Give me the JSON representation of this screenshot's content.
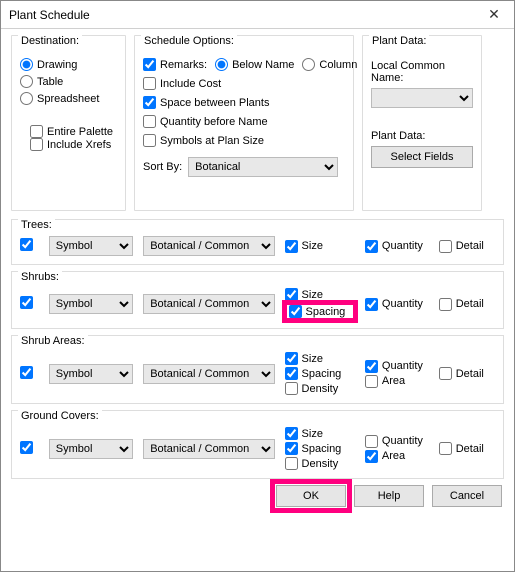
{
  "window": {
    "title": "Plant Schedule",
    "close_icon": "✕"
  },
  "destination": {
    "legend": "Destination:",
    "radios": {
      "drawing": "Drawing",
      "table": "Table",
      "spreadsheet": "Spreadsheet"
    },
    "entire_palette": "Entire Palette",
    "include_xrefs": "Include Xrefs"
  },
  "options": {
    "legend": "Schedule Options:",
    "remarks": "Remarks:",
    "below_name": "Below Name",
    "column": "Column",
    "include_cost": "Include Cost",
    "space_between": "Space between Plants",
    "qty_before": "Quantity before Name",
    "symbols_plan": "Symbols at Plan Size",
    "sort_by": "Sort By:",
    "sort_value": "Botanical"
  },
  "plantdata": {
    "legend": "Plant Data:",
    "lcn_label": "Local Common Name:",
    "lcn_value": "",
    "pd_label": "Plant Data:",
    "select_fields": "Select Fields"
  },
  "columns": {
    "symbol": "Symbol",
    "name": "Botanical / Common",
    "size": "Size",
    "spacing": "Spacing",
    "density": "Density",
    "quantity": "Quantity",
    "area": "Area",
    "detail": "Detail"
  },
  "sections": {
    "trees": {
      "legend": "Trees:"
    },
    "shrubs": {
      "legend": "Shrubs:"
    },
    "shrub_areas": {
      "legend": "Shrub Areas:"
    },
    "ground_covers": {
      "legend": "Ground Covers:"
    }
  },
  "footer": {
    "ok": "OK",
    "help": "Help",
    "cancel": "Cancel"
  }
}
